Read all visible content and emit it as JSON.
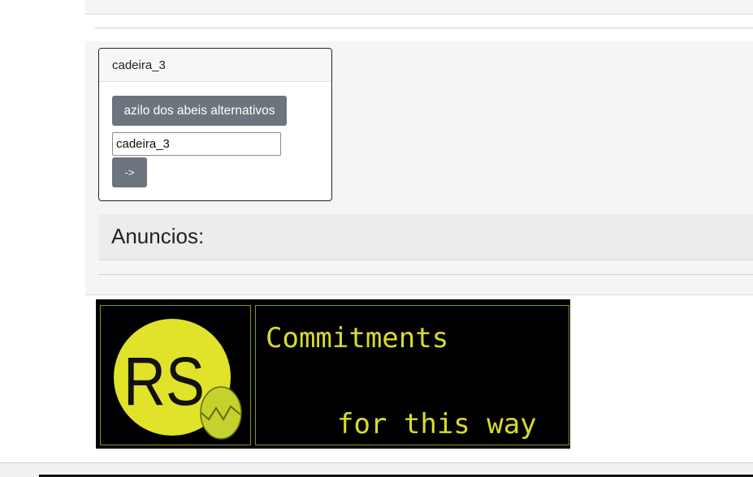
{
  "card": {
    "title": "cadeira_3",
    "alt_button_label": "azilo dos abeis alternativos",
    "input_value": "cadeira_3",
    "go_button_label": "->"
  },
  "announcements": {
    "heading": "Anuncios:"
  },
  "banner": {
    "logo_text": "RS",
    "line1": "Commitments",
    "line2": "for this way",
    "colors": {
      "background": "#000000",
      "accent": "#d8dc2a",
      "egg": "#c6d12e"
    }
  },
  "colors": {
    "button": "#6c757d",
    "panel": "#f5f5f5"
  }
}
